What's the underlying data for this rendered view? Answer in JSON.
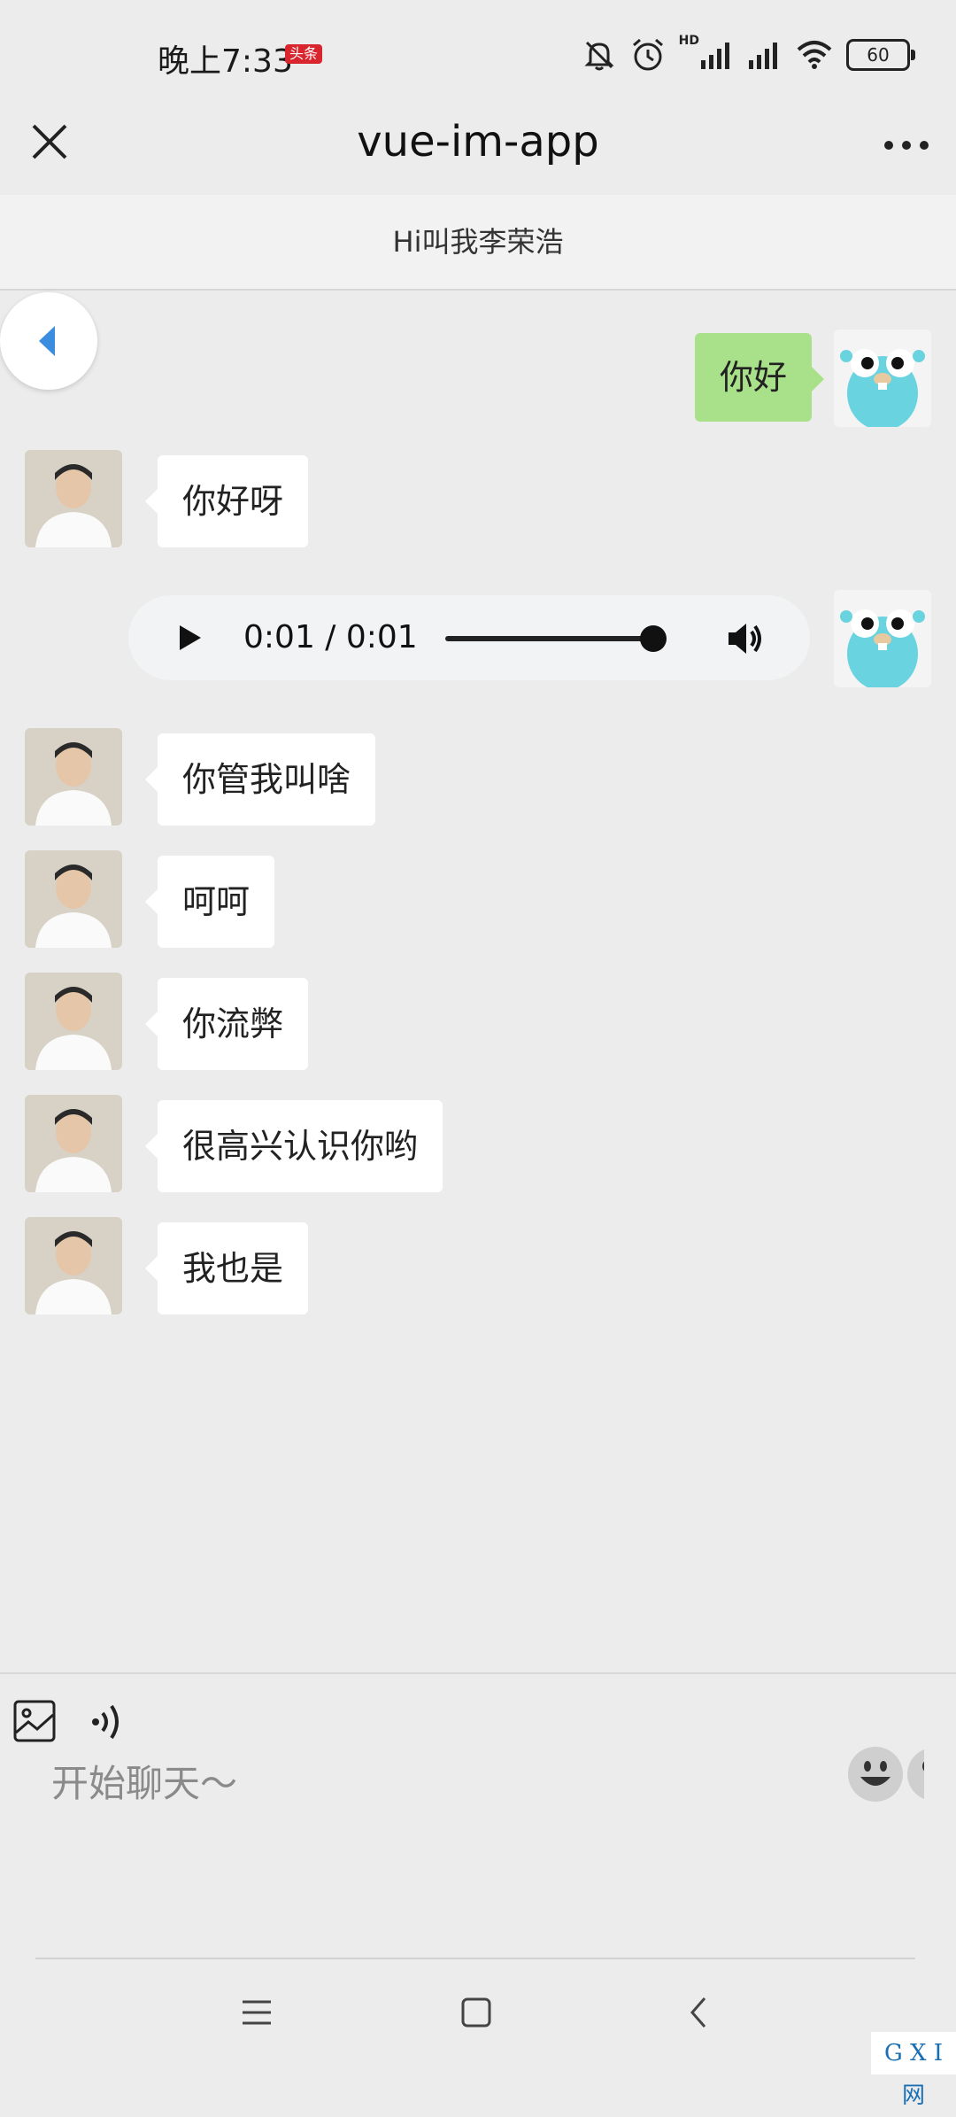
{
  "status_bar": {
    "time": "晚上7:33",
    "badge": "头条",
    "hd_label": "HD",
    "battery": "60"
  },
  "header": {
    "title": "vue-im-app"
  },
  "subtitle": "Hi叫我李荣浩",
  "messages": [
    {
      "side": "right",
      "text": "你好"
    },
    {
      "side": "left",
      "text": "你好呀"
    },
    {
      "side": "right",
      "type": "audio",
      "time": "0:01 / 0:01"
    },
    {
      "side": "left",
      "text": "你管我叫啥"
    },
    {
      "side": "left",
      "text": "呵呵"
    },
    {
      "side": "left",
      "text": "你流弊"
    },
    {
      "side": "left",
      "text": "很高兴认识你哟"
    },
    {
      "side": "left",
      "text": "我也是"
    }
  ],
  "input": {
    "placeholder": "开始聊天～"
  },
  "watermark": "G X I 网",
  "colors": {
    "background": "#ececec",
    "bubble_right": "#a9e18a",
    "bubble_left": "#ffffff",
    "back_arrow": "#3b8de0"
  }
}
